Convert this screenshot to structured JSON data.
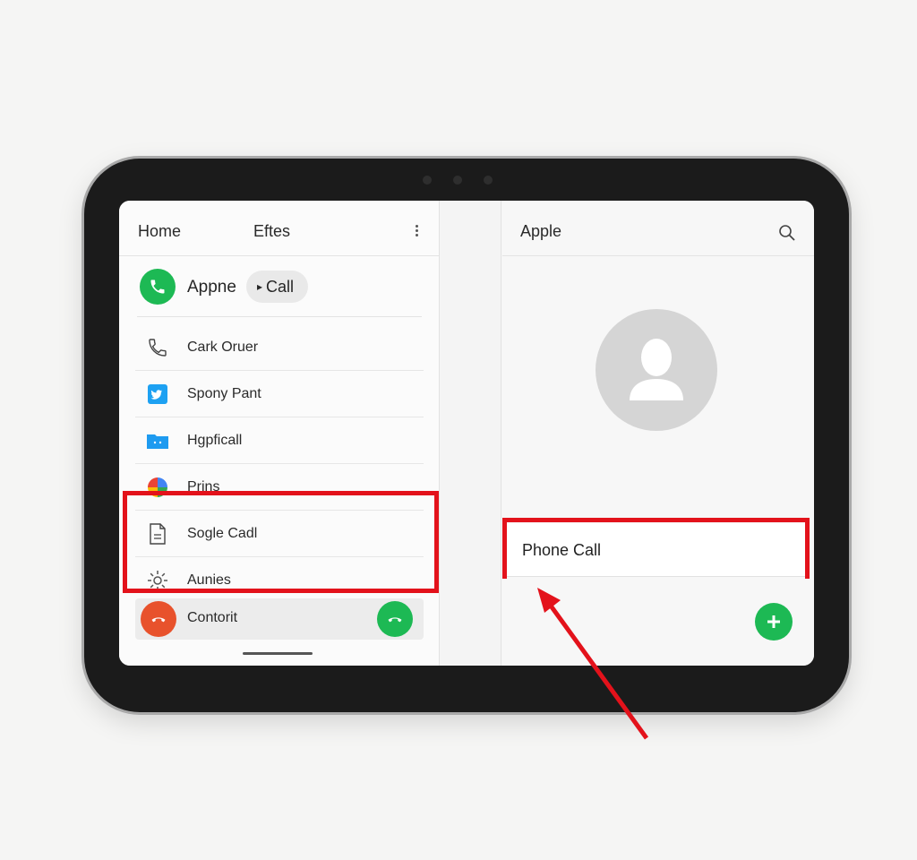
{
  "left_pane": {
    "tabs": [
      "Home",
      "Eftes"
    ],
    "menu_icon": "more-vertical-icon",
    "call_row": {
      "contact_name": "Appne",
      "call_button": "Call",
      "call_icon": "phone-icon"
    },
    "items": [
      {
        "label": "Cark Oruer",
        "icon": "phone-outline-icon"
      },
      {
        "label": "Spony Pant",
        "icon": "twitter-icon"
      },
      {
        "label": "Hgpficall",
        "icon": "folder-icon"
      },
      {
        "label": "Prins",
        "icon": "color-wheel-icon"
      },
      {
        "label": "Sogle Cadl",
        "icon": "document-icon"
      },
      {
        "label": "Aunies",
        "icon": "settings-icon"
      }
    ],
    "bottom_row": {
      "label": "Contorit",
      "decline_icon": "hang-up-icon",
      "answer_icon": "answer-call-icon"
    }
  },
  "right_pane": {
    "title": "Apple",
    "search_icon": "search-icon",
    "avatar": "person-icon",
    "phone_call_label": "Phone Call",
    "add_icon": "plus-icon"
  },
  "colors": {
    "accent_green": "#1db954",
    "decline_red": "#e8522c",
    "highlight_red": "#e3121b",
    "bezel": "#1b1b1b"
  }
}
